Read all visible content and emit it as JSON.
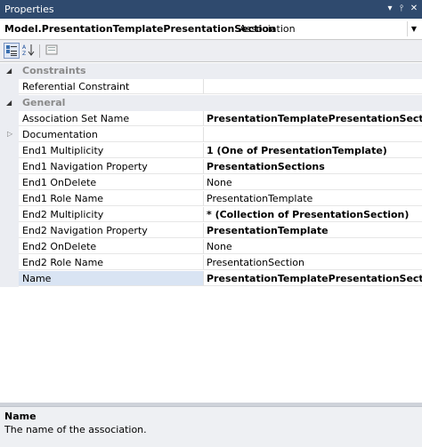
{
  "window": {
    "title": "Properties"
  },
  "selector": {
    "object_name": "Model.PresentationTemplatePresentationSection",
    "object_type": "Association"
  },
  "categories": [
    {
      "name": "Constraints",
      "rows": [
        {
          "name": "Referential Constraint",
          "value": "",
          "bold": false
        }
      ]
    },
    {
      "name": "General",
      "rows": [
        {
          "name": "Association Set Name",
          "value": "PresentationTemplatePresentationSection",
          "bold": true
        },
        {
          "name": "Documentation",
          "value": "",
          "bold": false,
          "expandable": true
        },
        {
          "name": "End1 Multiplicity",
          "value": "1 (One of PresentationTemplate)",
          "bold": true
        },
        {
          "name": "End1 Navigation Property",
          "value": "PresentationSections",
          "bold": true
        },
        {
          "name": "End1 OnDelete",
          "value": "None",
          "bold": false
        },
        {
          "name": "End1 Role Name",
          "value": "PresentationTemplate",
          "bold": false
        },
        {
          "name": "End2 Multiplicity",
          "value": "* (Collection of PresentationSection)",
          "bold": true
        },
        {
          "name": "End2 Navigation Property",
          "value": "PresentationTemplate",
          "bold": true
        },
        {
          "name": "End2 OnDelete",
          "value": "None",
          "bold": false
        },
        {
          "name": "End2 Role Name",
          "value": "PresentationSection",
          "bold": false
        },
        {
          "name": "Name",
          "value": "PresentationTemplatePresentationSection",
          "bold": true,
          "selected": true
        }
      ]
    }
  ],
  "description": {
    "title": "Name",
    "text": "The name of the association."
  },
  "icons": {
    "pin": "pin-icon",
    "close": "close-icon",
    "dropdown": "chevron-down-icon",
    "categorized": "categorized-icon",
    "alphabetical": "alphabetical-sort-icon",
    "property_pages": "property-pages-icon"
  }
}
